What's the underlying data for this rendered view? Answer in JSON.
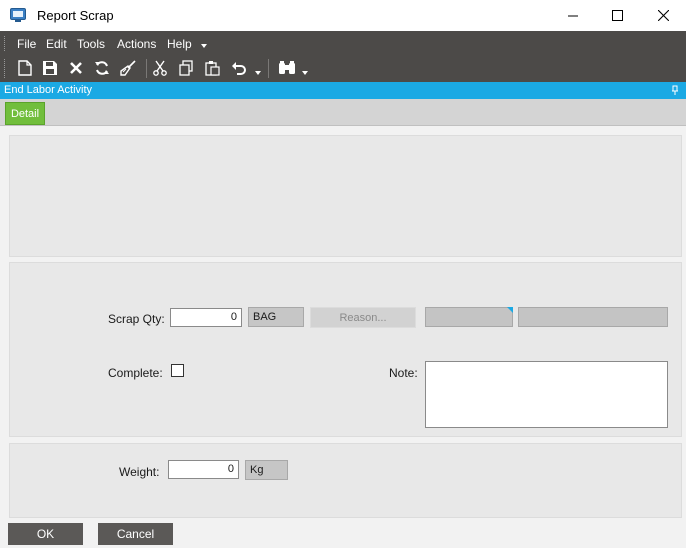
{
  "window": {
    "title": "Report Scrap",
    "icons": {
      "app": "app-window-icon",
      "minimize": "minimize-icon",
      "maximize": "maximize-icon",
      "close": "close-icon"
    }
  },
  "menu": {
    "items": [
      "File",
      "Edit",
      "Tools",
      "Actions",
      "Help"
    ]
  },
  "toolbar": {
    "icons": [
      "new-icon",
      "save-icon",
      "delete-icon",
      "refresh-icon",
      "clear-icon",
      "cut-icon",
      "copy-icon",
      "paste-icon",
      "undo-icon",
      "search-icon"
    ]
  },
  "section": {
    "title": "End Labor Activity"
  },
  "tabs": [
    {
      "label": "Detail",
      "active": true
    }
  ],
  "form": {
    "scrap_qty_label": "Scrap Qty:",
    "scrap_qty_value": "0",
    "scrap_uom": "BAG",
    "reason_label": "Reason...",
    "complete_label": "Complete:",
    "complete_checked": false,
    "note_label": "Note:",
    "note_value": "",
    "weight_label": "Weight:",
    "weight_value": "0",
    "weight_uom": "Kg"
  },
  "footer": {
    "ok_label": "OK",
    "cancel_label": "Cancel"
  },
  "colors": {
    "accent": "#1ba9e4",
    "tab_active": "#71be3c",
    "bar_dark": "#4c4a48"
  }
}
